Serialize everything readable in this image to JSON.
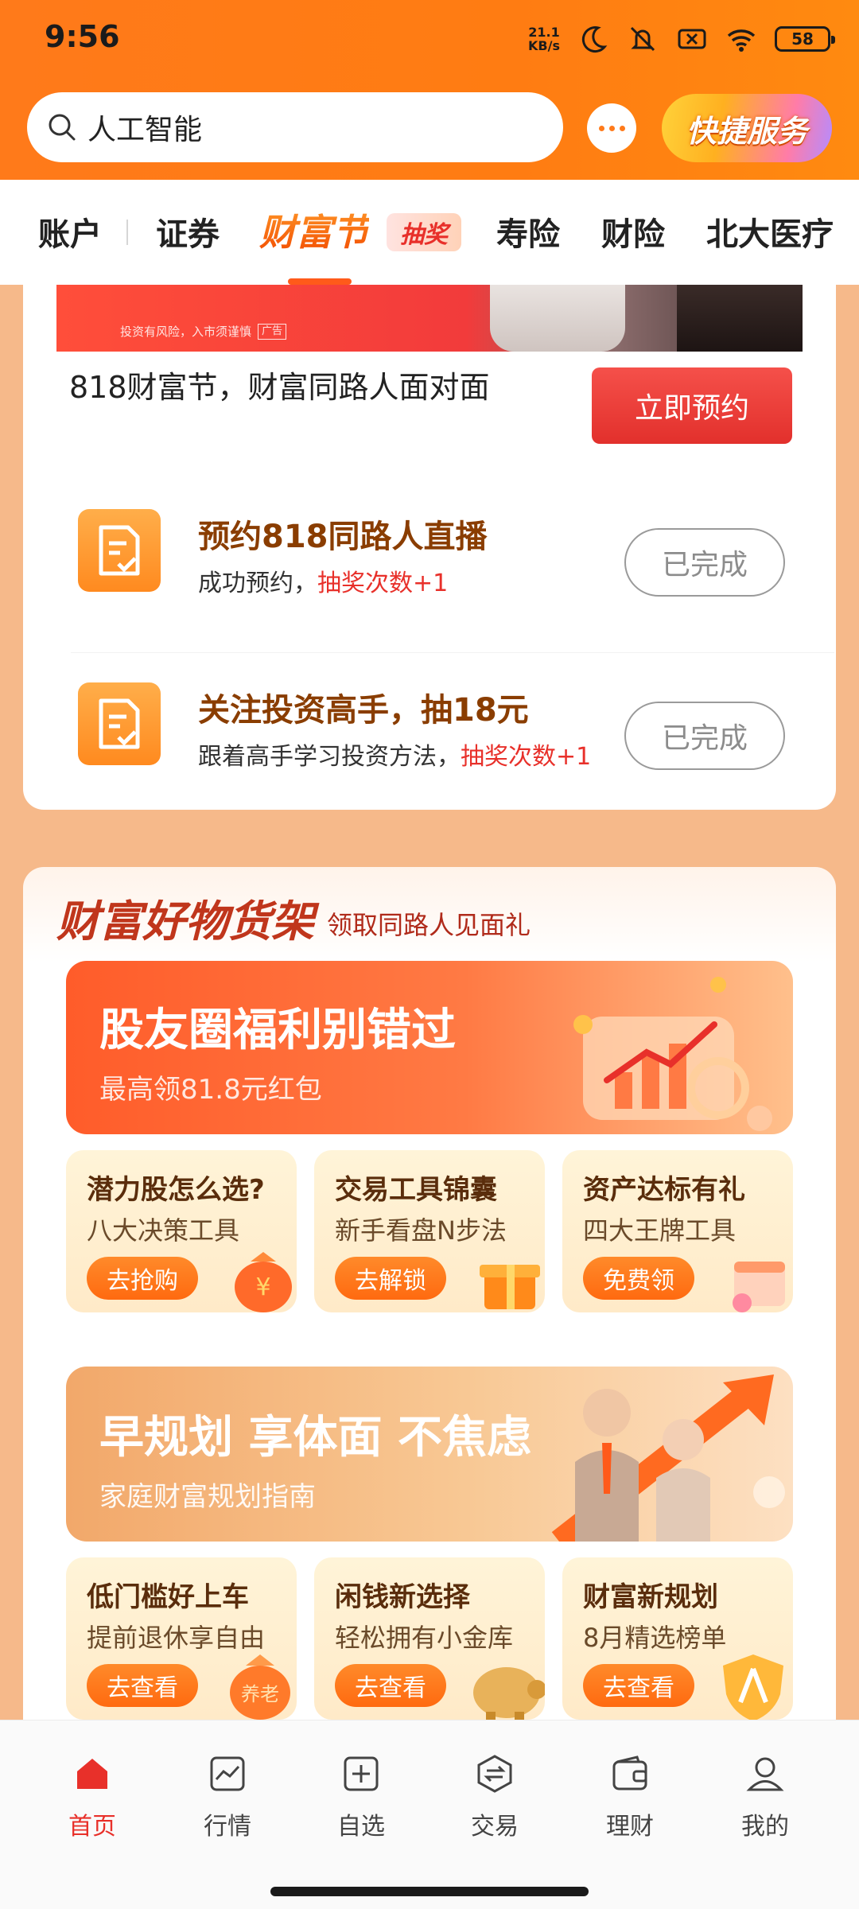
{
  "status_bar": {
    "time": "9:56",
    "net_speed_value": "21.1",
    "net_speed_unit": "KB/s",
    "battery": "58",
    "icons": [
      "moon-icon",
      "mute-icon",
      "no-sim-icon",
      "wifi-icon",
      "battery-icon"
    ]
  },
  "search": {
    "query": "人工智能"
  },
  "header": {
    "quick_service_label": "快捷服务"
  },
  "tabs": {
    "items": [
      "账户",
      "证券",
      "财富节",
      "寿险",
      "财险",
      "北大医疗"
    ],
    "badge": "抽奖",
    "active": "财富节"
  },
  "event_card": {
    "risk_note": "投资有风险，入市须谨慎",
    "ad_tag": "广告",
    "title": "818财富节，财富同路人面对面",
    "reserve_button": "立即预约",
    "tasks": [
      {
        "title": "预约818同路人直播",
        "desc": "成功预约，",
        "reward": "抽奖次数+1",
        "button": "已完成"
      },
      {
        "title": "关注投资高手，抽18元",
        "desc": "跟着高手学习投资方法，",
        "reward": "抽奖次数+1",
        "button": "已完成"
      }
    ]
  },
  "shelf": {
    "title": "财富好物货架",
    "subtitle": "领取同路人见面礼",
    "banner1": {
      "title": "股友圈福利别错过",
      "subtitle": "最高领81.8元红包"
    },
    "row1": [
      {
        "title": "潜力股怎么选?",
        "sub": "八大决策工具",
        "button": "去抢购"
      },
      {
        "title": "交易工具锦囊",
        "sub": "新手看盘N步法",
        "button": "去解锁"
      },
      {
        "title": "资产达标有礼",
        "sub": "四大王牌工具",
        "button": "免费领"
      }
    ],
    "banner2": {
      "title": "早规划 享体面 不焦虑",
      "subtitle": "家庭财富规划指南"
    },
    "row2": [
      {
        "title": "低门槛好上车",
        "sub": "提前退休享自由",
        "button": "去查看",
        "tag": "养老"
      },
      {
        "title": "闲钱新选择",
        "sub": "轻松拥有小金库",
        "button": "去查看"
      },
      {
        "title": "财富新规划",
        "sub": "8月精选榜单",
        "button": "去查看"
      }
    ]
  },
  "bottom_nav": {
    "items": [
      "首页",
      "行情",
      "自选",
      "交易",
      "理财",
      "我的"
    ],
    "active": "首页"
  },
  "colors": {
    "brand_orange": "#ff7a1a",
    "accent_red": "#e8302a",
    "background": "#f6b98a"
  }
}
